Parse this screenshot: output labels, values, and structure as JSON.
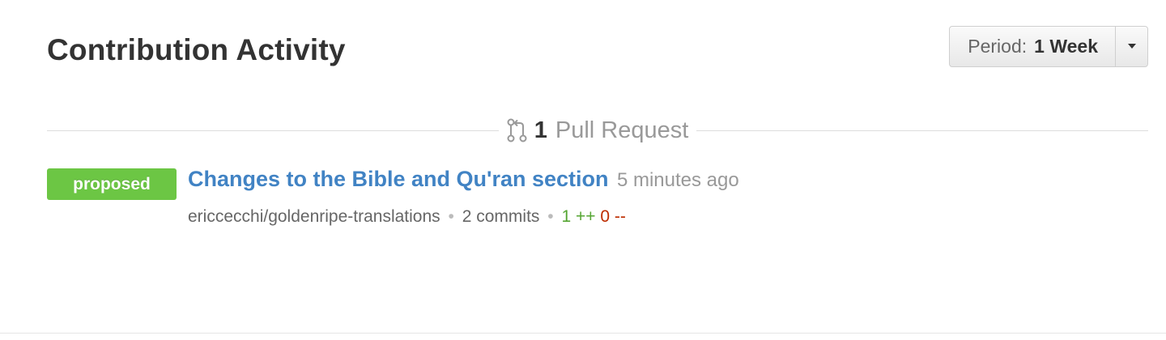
{
  "header": {
    "title": "Contribution Activity",
    "period_label": "Period:",
    "period_value": "1 Week"
  },
  "section": {
    "count": "1",
    "label": "Pull Request",
    "icon": "git-pull-request-icon"
  },
  "pull_requests": [
    {
      "status": "proposed",
      "title": "Changes to the Bible and Qu'ran section",
      "time": "5 minutes ago",
      "repo": "ericcecchi/goldenripe-translations",
      "commits": "2 commits",
      "additions": "1",
      "additions_suffix": "++",
      "deletions": "0",
      "deletions_suffix": "--"
    }
  ],
  "colors": {
    "badge": "#6cc644",
    "link": "#4183c4",
    "additions": "#55a532",
    "deletions": "#bd2c00"
  }
}
